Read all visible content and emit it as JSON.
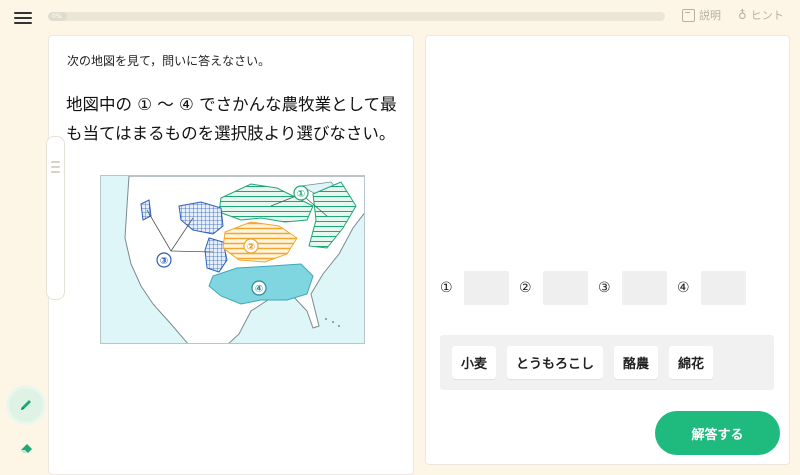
{
  "header": {
    "progress_percent": 3,
    "progress_label": "0%",
    "explain_label": "説明",
    "hint_label": "ヒント"
  },
  "question": {
    "instruction": "次の地図を見て，問いに答えなさい。",
    "text": "地図中の ① 〜 ④ でさかんな農牧業として最も当てはまるものを選択肢より選びなさい。"
  },
  "map": {
    "labels": [
      "①",
      "②",
      "③",
      "④"
    ],
    "colors": {
      "region1": "#1fa876",
      "region2": "#f0a830",
      "region3": "#2d5fbf",
      "region4": "#7fd6e0",
      "land": "#ffffff",
      "water": "#dff6f8"
    }
  },
  "answers": {
    "slots": [
      {
        "label": "①",
        "value": ""
      },
      {
        "label": "②",
        "value": ""
      },
      {
        "label": "③",
        "value": ""
      },
      {
        "label": "④",
        "value": ""
      }
    ],
    "choices": [
      "小麦",
      "とうもろこし",
      "酪農",
      "綿花"
    ],
    "submit_label": "解答する"
  },
  "colors": {
    "accent": "#1fba7d",
    "background": "#fdf6e7"
  },
  "tools": {
    "pen_icon": "pencil-icon",
    "eraser_icon": "eraser-icon"
  }
}
